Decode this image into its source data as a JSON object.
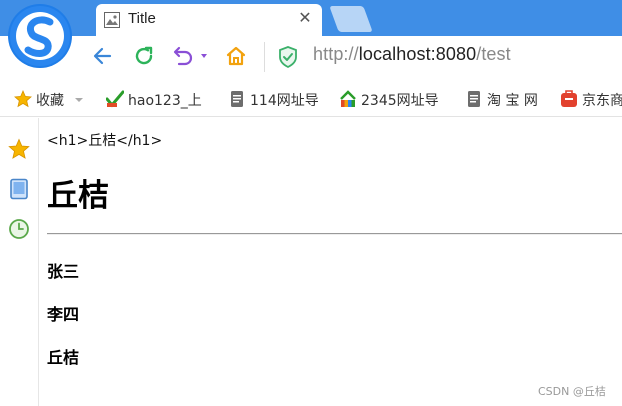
{
  "tab": {
    "title": "Title",
    "close_glyph": "✕"
  },
  "address": {
    "prefix": "http://",
    "host": "localhost:8080",
    "path": "/test"
  },
  "bookmarks": [
    {
      "label": "收藏",
      "icon": "star-icon"
    },
    {
      "label": "hao123_上",
      "icon": "hao123-icon"
    },
    {
      "label": "114网址导",
      "icon": "page-icon"
    },
    {
      "label": "2345网址导",
      "icon": "2345-icon"
    },
    {
      "label": "淘 宝 网",
      "icon": "page-icon"
    },
    {
      "label": "京东商",
      "icon": "jd-icon"
    }
  ],
  "page": {
    "raw_text": "<h1>丘桔</h1>",
    "heading": "丘桔",
    "names": [
      "张三",
      "李四",
      "丘桔"
    ]
  },
  "watermark": "CSDN @丘桔",
  "colors": {
    "tabbar": "#3f8ee6",
    "accent": "#1f7de8"
  }
}
